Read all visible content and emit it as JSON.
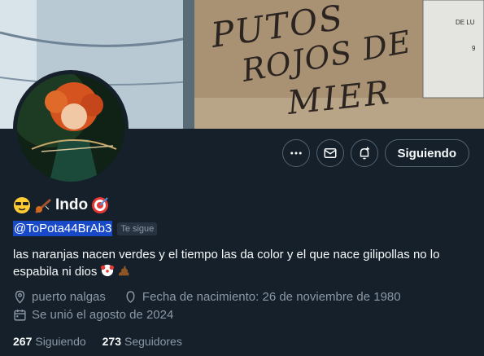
{
  "profile": {
    "display_name": "Indo",
    "handle": "@ToPota44BrAb3",
    "follows_you": "Te sigue",
    "bio_line1": "las naranjas nacen verdes y el tiempo las da color y el que nace gilipollas no lo",
    "bio_line2": "espabila ni dios",
    "location": "puerto nalgas",
    "birthday": "Fecha de nacimiento: 26 de noviembre de 1980",
    "joined": "Se unió el agosto de 2024"
  },
  "banner_graffiti": {
    "line1": "PUTOS",
    "line2": "ROJOS DE",
    "line3": "MIER",
    "sign1": "DE LU",
    "sign2": "9"
  },
  "actions": {
    "follow_label": "Siguiendo"
  },
  "stats": {
    "following_count": "267",
    "following_label": "Siguiendo",
    "followers_count": "273",
    "followers_label": "Seguidores"
  },
  "icons": [
    "more-icon",
    "message-icon",
    "notify-icon",
    "location-icon",
    "birthday-icon",
    "calendar-icon"
  ],
  "colors": {
    "background": "#15202b",
    "secondary_text": "#8b98a5",
    "handle_highlight": "#1749c8",
    "border": "#536471"
  }
}
